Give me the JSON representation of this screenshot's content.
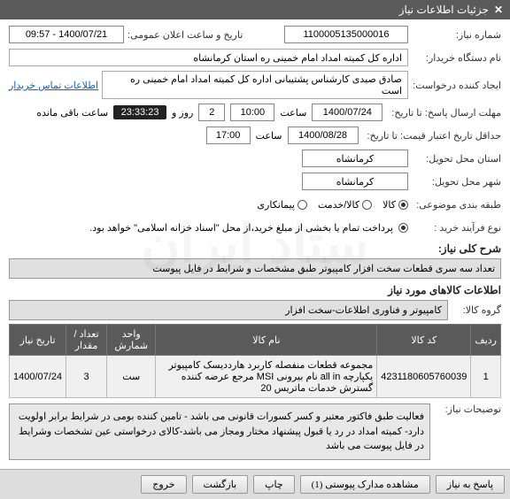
{
  "header": {
    "title": "جزئیات اطلاعات نیاز"
  },
  "fields": {
    "need_no_label": "شماره نیاز:",
    "need_no": "1100005135000016",
    "announce_label": "تاریخ و ساعت اعلان عمومی:",
    "announce_value": "1400/07/21 - 09:57",
    "buyer_label": "نام دستگاه خریدار:",
    "buyer_value": "اداره کل کمیته امداد امام خمینی  ره  استان کرمانشاه",
    "creator_label": "ایجاد کننده درخواست:",
    "creator_value": "صادق  صیدی  کارشناس پشتیبانی  اداره کل کمیته امداد امام خمینی  ره  است",
    "contact_link": "اطلاعات تماس خریدار",
    "deadline_label": "مهلت ارسال پاسخ: تا تاریخ:",
    "deadline_date": "1400/07/24",
    "time_label": "ساعت",
    "deadline_time": "10:00",
    "days_remaining": "2",
    "days_remaining_label": "روز و",
    "countdown": "23:33:23",
    "remaining_suffix": "ساعت باقی مانده",
    "validity_label": "حداقل تاریخ اعتبار قیمت: تا تاریخ:",
    "validity_date": "1400/08/28",
    "validity_time": "17:00",
    "province_label": "استان محل تحویل:",
    "province": "کرمانشاه",
    "city_label": "شهر محل تحویل:",
    "city": "کرمانشاه",
    "category_label": "طبقه بندی موضوعی:",
    "cat_goods": "کالا",
    "cat_service": "کالا/خدمت",
    "cat_contract": "پیمانکاری",
    "process_label": "نوع فرآیند خرید :",
    "process_text": "پرداخت تمام یا بخشی از مبلغ خرید،از محل \"اسناد خزانه اسلامی\" خواهد بود.",
    "desc_title": "شرح کلی نیاز:",
    "desc_text": "تعداد سه سری قطعات سخت افزار کامپیوتر طبق مشخصات و شرایط در فایل پیوست",
    "goods_title": "اطلاعات کالاهای مورد نیاز",
    "group_label": "گروه کالا:",
    "group_value": "کامپیوتر و فناوری اطلاعات-سخت افزار",
    "notes_label": "توضیحات نیاز:",
    "notes_text": "فعالیت طبق فاکتور معتبر و کسر کسورات قانونی می باشد - تامین کننده بومی در شرایط برابر اولویت دارد- کمیته امداد در رد یا قبول پیشنهاد مختار ومجاز می باشد-کالای درخواستی عین تشخصات وشرایط در فایل پیوست می باشد"
  },
  "table": {
    "headers": [
      "ردیف",
      "کد کالا",
      "نام کالا",
      "واحد شمارش",
      "تعداد / مقدار",
      "تاریخ نیاز"
    ],
    "rows": [
      {
        "idx": "1",
        "code": "4231180605760039",
        "name": "مجموعه قطعات منفصله کاربرد هارددیسک کامپیوتر یکپارچه all in نام بیرونی MSI مرجع عرضه کننده گسترش خدمات ماتریس 20",
        "unit": "ست",
        "qty": "3",
        "date": "1400/07/24"
      }
    ]
  },
  "buttons": {
    "answer": "پاسخ به نیاز",
    "attachments": "مشاهده مدارک پیوستی (1)",
    "print": "چاپ",
    "back": "بازگشت",
    "exit": "خروج"
  }
}
